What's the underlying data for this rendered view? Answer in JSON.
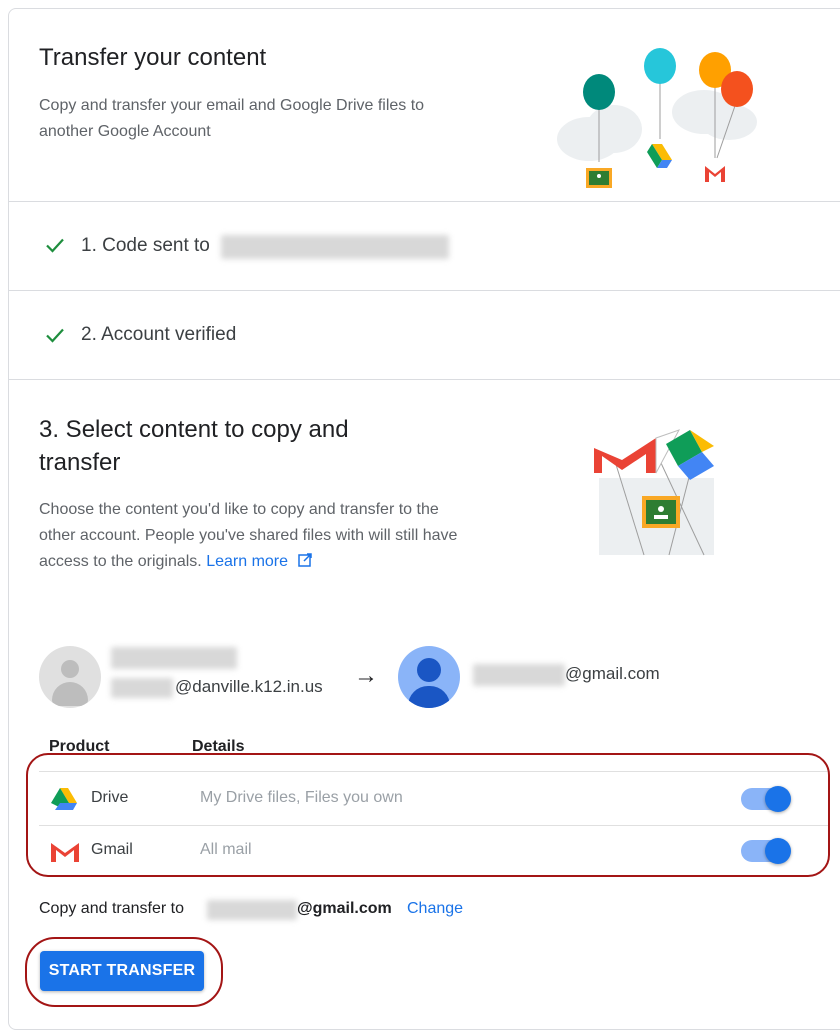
{
  "header": {
    "title": "Transfer your content",
    "description": "Copy and transfer your email and Google Drive files to another Google Account"
  },
  "steps": [
    {
      "label": "1. Code sent to",
      "status": "complete"
    },
    {
      "label": "2. Account verified",
      "status": "complete"
    }
  ],
  "select": {
    "title": "3. Select content to copy and transfer",
    "description": "Choose the content you'd like to copy and transfer to the other account. People you've shared files with will still have access to the originals.",
    "learn_more": "Learn more"
  },
  "accounts": {
    "source_domain": "@danville.k12.in.us",
    "arrow": "→",
    "dest_domain": "@gmail.com"
  },
  "table": {
    "headers": [
      "Product",
      "Details"
    ],
    "rows": [
      {
        "product": "Drive",
        "details": "My Drive files, Files you own",
        "icon": "drive-icon",
        "enabled": true
      },
      {
        "product": "Gmail",
        "details": "All mail",
        "icon": "gmail-icon",
        "enabled": true
      }
    ]
  },
  "footer": {
    "copy_label": "Copy and transfer to",
    "dest_domain": "@gmail.com",
    "change_label": "Change",
    "start_button": "START TRANSFER"
  },
  "colors": {
    "accent": "#1a73e8",
    "check": "#1e8e3e",
    "annotation": "#a31515"
  }
}
